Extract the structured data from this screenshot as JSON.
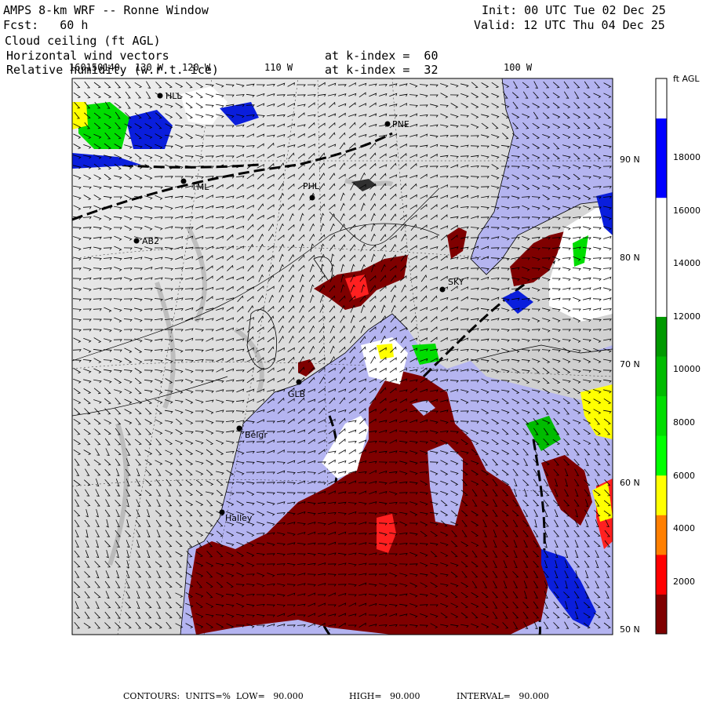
{
  "header": {
    "title": "AMPS 8-km WRF -- Ronne Window",
    "fcst": "Fcst:   60 h",
    "field1": "Cloud ceiling (ft AGL)",
    "field2": "Horizontal wind vectors",
    "field3": "Relative humidity (w.r.t. ice)",
    "level1": "at k-index =  60",
    "level2": "at k-index =  32",
    "init": "Init: 00 UTC Tue 02 Dec 25",
    "valid": "Valid: 12 UTC Thu 04 Dec 25"
  },
  "lon_labels": [
    "160150140",
    "130 W",
    "120 W",
    "110 W",
    "100 W"
  ],
  "lat_labels": [
    "90 N",
    "80 N",
    "70 N",
    "60 N",
    "50 N"
  ],
  "stations": [
    {
      "name": "HLL"
    },
    {
      "name": "PNE"
    },
    {
      "name": "TML"
    },
    {
      "name": "PHL"
    },
    {
      "name": "AB2"
    },
    {
      "name": "SKY"
    },
    {
      "name": "GLB"
    },
    {
      "name": "Belgr"
    },
    {
      "name": "Halley"
    }
  ],
  "legend": {
    "units": "ft AGL",
    "bands": [
      {
        "color": "#7f0000"
      },
      {
        "color": "#ff0000"
      },
      {
        "color": "#ff7f00"
      },
      {
        "color": "#ffff00"
      },
      {
        "color": "#00ff00"
      },
      {
        "color": "#00dd00"
      },
      {
        "color": "#00bb00"
      },
      {
        "color": "#009900"
      },
      {
        "color": "#ffffff"
      },
      {
        "color": "#ffffff"
      },
      {
        "color": "#ffffff"
      },
      {
        "color": "#0000ff"
      },
      {
        "color": "#0000ff"
      },
      {
        "color": "#ffffff"
      }
    ],
    "labels": [
      "2000",
      "4000",
      "6000",
      "8000",
      "10000",
      "12000",
      "14000",
      "16000",
      "18000"
    ]
  },
  "colors": {
    "ocean": "#b4b4f0",
    "land_light": "#e6e6e6",
    "land_mid": "#cfcfcf",
    "cloud_low": "#7f0000",
    "cloud_red": "#ff2020",
    "cloud_high": "#0a1edc",
    "cloud_white": "#ffffff"
  },
  "footer": {
    "contours": "CONTOURS:  UNITS=%  LOW=   90.000",
    "high": "HIGH=   90.000",
    "interval": "INTERVAL=   90.000"
  }
}
